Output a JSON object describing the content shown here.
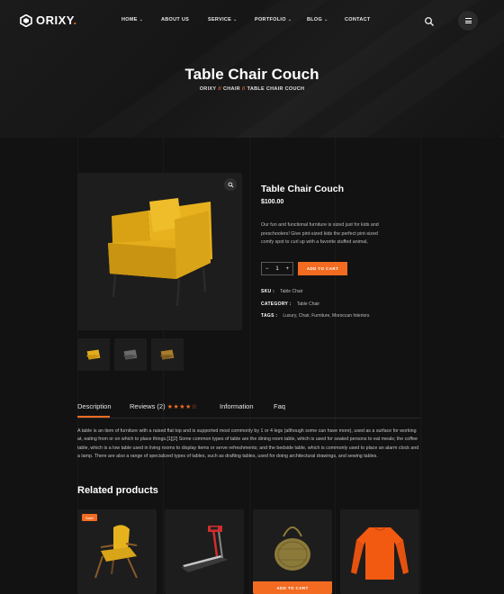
{
  "brand": {
    "name": "ORIXY",
    "dot": "."
  },
  "nav": [
    {
      "label": "HOME",
      "dropdown": true
    },
    {
      "label": "ABOUT US",
      "dropdown": false
    },
    {
      "label": "SERVICE",
      "dropdown": true
    },
    {
      "label": "PORTFOLIO",
      "dropdown": true
    },
    {
      "label": "BLOG",
      "dropdown": true
    },
    {
      "label": "CONTACT",
      "dropdown": false
    }
  ],
  "hero": {
    "title": "Table Chair Couch",
    "breadcrumb": [
      "ORIXY",
      "CHAIR",
      "TABLE CHAIR COUCH"
    ],
    "separator": "//"
  },
  "product": {
    "title": "Table Chair Couch",
    "price": "$100.00",
    "description": "Our fun and functional furniture is sized just for kids and preschoolers! Give pint-sized kids the perfect pint-sized comfy spot to curl up with a favorite stuffed animal,",
    "quantity": "1",
    "minus": "−",
    "plus": "+",
    "add_to_cart": "ADD TO CART",
    "sku_label": "SKU :",
    "sku": "Table Chair",
    "category_label": "CATEGORY :",
    "category": "Table Chair",
    "tags_label": "TAGS :",
    "tags": "Luxury, Chair, Furniture, Moroccan Interiors"
  },
  "tabs": {
    "description": "Description",
    "reviews": "Reviews (2)",
    "reviews_stars": "★★★★☆",
    "reviews_rating": 4,
    "information": "Information",
    "faq": "Faq"
  },
  "description_text": "A table is an item of furniture with a raised flat top and is supported most commonly by 1 or 4 legs (although some can have more), used as a surface for working at, eating from or on which to place things.[1][2] Some common types of table are the dining room table, which is used for seated persons to eat meals; the coffee table, which is a low table used in living rooms to display items or serve refreshments; and the bedside table, which is commonly used to place an alarm clock and a lamp. There are also a range of specialized types of tables, such as drafting tables, used for doing architectural drawings, and sewing tables.",
  "related": {
    "title": "Related products",
    "sale_badge": "Sale!",
    "add_to_cart": "ADD TO CART"
  },
  "colors": {
    "accent": "#f26b21",
    "background": "#121212",
    "panel": "#1d1d1d",
    "chair": "#e3ad1b"
  },
  "icons": [
    "search-icon",
    "menu-icon",
    "zoom-icon",
    "logo-icon"
  ]
}
